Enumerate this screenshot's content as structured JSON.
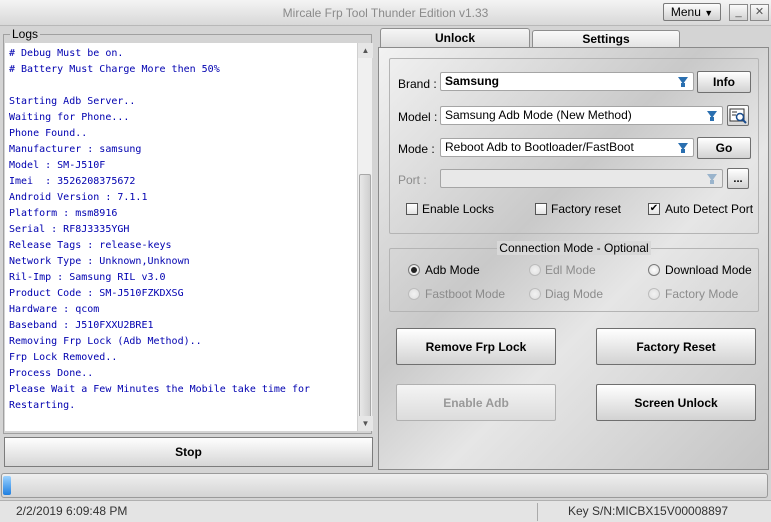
{
  "window": {
    "title": "Mircale Frp Tool Thunder Edition v1.33"
  },
  "menu": {
    "label": "Menu",
    "arrow": "triangle-down-icon"
  },
  "caption_buttons": {
    "minimize": "_",
    "close": "✕"
  },
  "logs": {
    "label": "Logs",
    "lines": [
      "# Debug Must be on.",
      "# Battery Must Charge More then 50%",
      "",
      "Starting Adb Server..",
      "Waiting for Phone...",
      "Phone Found..",
      "Manufacturer : samsung",
      "Model : SM-J510F",
      "Imei  : 3526208375672",
      "Android Version : 7.1.1",
      "Platform : msm8916",
      "Serial : RF8J3335YGH",
      "Release Tags : release-keys",
      "Network Type : Unknown,Unknown",
      "Ril-Imp : Samsung RIL v3.0",
      "Product Code : SM-J510FZKDXSG",
      "Hardware : qcom",
      "Baseband : J510FXXU2BRE1",
      "Removing Frp Lock (Adb Method)..",
      "Frp Lock Removed..",
      "Process Done..",
      "Please Wait a Few Minutes the Mobile take time for",
      "Restarting."
    ]
  },
  "stop_button": "Stop",
  "tabs": [
    {
      "label": "Unlock",
      "active": true
    },
    {
      "label": "Settings",
      "active": false
    }
  ],
  "device": {
    "brand": {
      "label": "Brand :",
      "value": "Samsung"
    },
    "model": {
      "label": "Model :",
      "value": "Samsung Adb Mode (New Method)"
    },
    "mode": {
      "label": "Mode :",
      "value": "Reboot Adb to Bootloader/FastBoot"
    },
    "port": {
      "label": "Port :",
      "value": ""
    },
    "info_button": "Info",
    "go_button": "Go",
    "port_browse_button": "...",
    "checkboxes": [
      {
        "label": "Enable Locks",
        "checked": false
      },
      {
        "label": "Factory reset",
        "checked": false
      },
      {
        "label": "Auto Detect Port",
        "checked": true
      }
    ]
  },
  "connection": {
    "caption": "Connection Mode - Optional",
    "modes": [
      {
        "label": "Adb Mode",
        "selected": true,
        "enabled": true
      },
      {
        "label": "Edl Mode",
        "selected": false,
        "enabled": false
      },
      {
        "label": "Download Mode",
        "selected": false,
        "enabled": true
      },
      {
        "label": "Fastboot Mode",
        "selected": false,
        "enabled": false
      },
      {
        "label": "Diag Mode",
        "selected": false,
        "enabled": false
      },
      {
        "label": "Factory Mode",
        "selected": false,
        "enabled": false
      }
    ]
  },
  "actions": {
    "remove_frp": "Remove Frp Lock",
    "factory_reset": "Factory Reset",
    "enable_adb": "Enable Adb",
    "screen_unlock": "Screen Unlock"
  },
  "progress": {
    "fraction": 0.01,
    "color": "#1f7fe0"
  },
  "status": {
    "datetime": "2/2/2019 6:09:48 PM",
    "key": "Key S/N:MICBX15V00008897"
  },
  "colors": {
    "log_text": "#0000b0",
    "dropdown_arrow": "#2a6fb0"
  }
}
